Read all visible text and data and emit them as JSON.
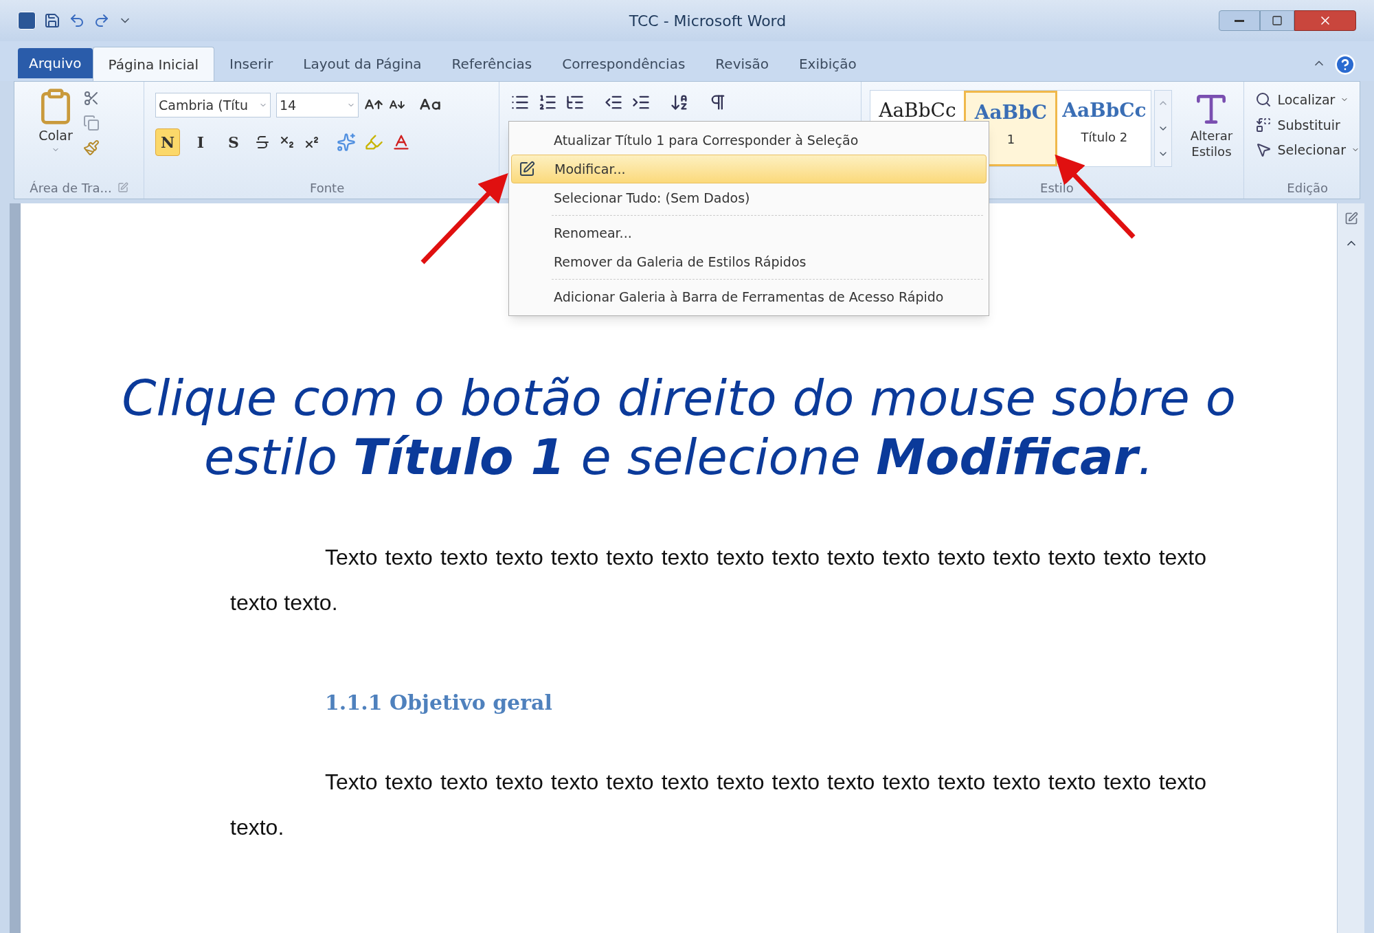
{
  "window": {
    "title": "TCC - Microsoft Word"
  },
  "tabs": [
    {
      "label": "Arquivo",
      "kind": "file",
      "selected": false
    },
    {
      "label": "Página Inicial",
      "kind": "tab",
      "selected": true
    },
    {
      "label": "Inserir",
      "kind": "tab",
      "selected": false
    },
    {
      "label": "Layout da Página",
      "kind": "tab",
      "selected": false
    },
    {
      "label": "Referências",
      "kind": "tab",
      "selected": false
    },
    {
      "label": "Correspondências",
      "kind": "tab",
      "selected": false
    },
    {
      "label": "Revisão",
      "kind": "tab",
      "selected": false
    },
    {
      "label": "Exibição",
      "kind": "tab",
      "selected": false
    }
  ],
  "clipboard": {
    "paste": "Colar",
    "label": "Área de Tra..."
  },
  "font": {
    "font_name": "Cambria (Títu",
    "font_size": "14",
    "label": "Fonte",
    "format_buttons": [
      {
        "label": "N",
        "selected": true
      },
      {
        "label": "I",
        "selected": false
      },
      {
        "label": "S",
        "selected": false
      }
    ]
  },
  "styles": {
    "label": "Estilo",
    "items": [
      {
        "preview": "AaBbCc",
        "selected": false
      },
      {
        "preview": "AaBbC",
        "name": "1",
        "selected": true
      },
      {
        "preview": "AaBbCc",
        "name": "Título 2",
        "selected": false
      }
    ],
    "change_styles": "Alterar Estilos"
  },
  "editing": {
    "label": "Edição",
    "items": [
      {
        "label": "Localizar",
        "dropdown": true
      },
      {
        "label": "Substituir",
        "dropdown": false
      },
      {
        "label": "Selecionar",
        "dropdown": true
      }
    ]
  },
  "context_menu": [
    {
      "label": "Atualizar Título 1 para Corresponder à Seleção",
      "selected": false,
      "separator_after": false
    },
    {
      "label": "Modificar...",
      "selected": true,
      "separator_after": false
    },
    {
      "label": "Selecionar Tudo: (Sem Dados)",
      "selected": false,
      "separator_after": true
    },
    {
      "label": "Renomear...",
      "selected": false,
      "separator_after": false
    },
    {
      "label": "Remover da Galeria de Estilos Rápidos",
      "selected": false,
      "separator_after": true
    },
    {
      "label": "Adicionar Galeria à Barra de Ferramentas de Acesso Rápido",
      "selected": false,
      "separator_after": false
    }
  ],
  "annotation": "Clique com o botão direito do mouse sobre o estilo **Título 1** e selecione **Modificar**.",
  "document": [
    {
      "kind": "paragraph",
      "text": "Texto texto texto texto texto texto texto texto texto texto texto texto texto texto texto texto texto texto."
    },
    {
      "kind": "heading",
      "text": "1.1.1 Objetivo geral"
    },
    {
      "kind": "paragraph",
      "text": "Texto texto texto texto texto texto texto texto texto texto texto texto texto texto texto texto texto."
    }
  ]
}
